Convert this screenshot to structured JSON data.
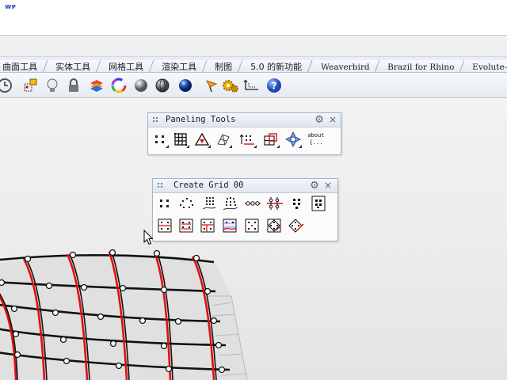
{
  "corner_logo": "ᴡᴘ",
  "tabs": [
    {
      "label": "曲面工具",
      "mono": false
    },
    {
      "label": "实体工具",
      "mono": false
    },
    {
      "label": "网格工具",
      "mono": false
    },
    {
      "label": "渲染工具",
      "mono": false
    },
    {
      "label": "制图",
      "mono": false
    },
    {
      "label": "5.0 的新功能",
      "mono": false
    },
    {
      "label": "Weaverbird",
      "mono": true
    },
    {
      "label": "Brazil for Rhino",
      "mono": true
    },
    {
      "label": "Evolute-I",
      "mono": true
    }
  ],
  "toolbar": {
    "icons": [
      "rotate-view-icon",
      "snapshot-icon",
      "light-bulb-icon",
      "lock-icon",
      "layer-stack-icon",
      "color-wheel-icon",
      "shade-sphere-icon",
      "rendered-sphere-icon",
      "blue-sphere-icon",
      "flamingo-icon",
      "gears-icon",
      "dimension-icon",
      "help-icon"
    ]
  },
  "panels": {
    "paneling_tools": {
      "title": "Paneling Tools",
      "about_label": "about",
      "about_sub": "{..."
    },
    "create_grid": {
      "title": "Create Grid 00"
    }
  },
  "colors": {
    "tab_bg": "#e9eef6",
    "accent_red": "#e01010",
    "curve_black": "#111111",
    "surface_gray": "#e2e2e2"
  }
}
